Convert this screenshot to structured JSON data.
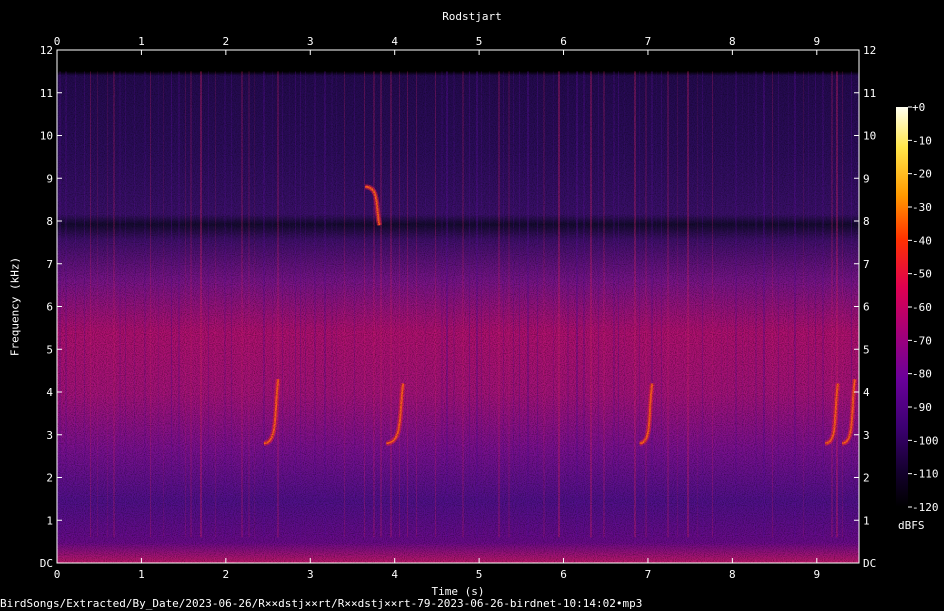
{
  "chart_data": {
    "type": "heatmap",
    "title": "Rodstjart",
    "xlabel": "Time (s)",
    "ylabel": "Frequency (kHz)",
    "xlim": [
      0,
      9.5
    ],
    "ylim": [
      0,
      12
    ],
    "x_ticks": [
      "0",
      "1",
      "2",
      "3",
      "4",
      "5",
      "6",
      "7",
      "8",
      "9"
    ],
    "y_ticks": [
      "DC",
      "1",
      "2",
      "3",
      "4",
      "5",
      "6",
      "7",
      "8",
      "9",
      "10",
      "11",
      "12"
    ],
    "colorbar": {
      "unit": "dBFS",
      "range": [
        -120,
        0
      ],
      "ticks": [
        "+0",
        "-10",
        "-20",
        "-30",
        "-40",
        "-50",
        "-60",
        "-70",
        "-80",
        "-90",
        "-100",
        "-110",
        "-120"
      ],
      "colormap": [
        "#fffff0",
        "#ffe64b",
        "#ff9a00",
        "#ff3200",
        "#e00050",
        "#a0007a",
        "#6a009a",
        "#3c0072",
        "#14002e",
        "#000000"
      ]
    },
    "calls": [
      {
        "t_start": 2.45,
        "t_end": 2.62,
        "f_start": 2.8,
        "f_end": 4.3
      },
      {
        "t_start": 3.9,
        "t_end": 4.1,
        "f_start": 2.8,
        "f_end": 4.2
      },
      {
        "t_start": 6.9,
        "t_end": 7.05,
        "f_start": 2.8,
        "f_end": 4.2
      },
      {
        "t_start": 9.1,
        "t_end": 9.25,
        "f_start": 2.8,
        "f_end": 4.2
      },
      {
        "t_start": 9.3,
        "t_end": 9.45,
        "f_start": 2.8,
        "f_end": 4.3
      },
      {
        "t_start": 3.65,
        "t_end": 3.82,
        "f_start": 8.8,
        "f_end": 7.9
      }
    ]
  },
  "footer": "BirdSongs/Extracted/By_Date/2023-06-26/R××dstj××rt/R××dstj××rt-79-2023-06-26-birdnet-10:14:02•mp3"
}
